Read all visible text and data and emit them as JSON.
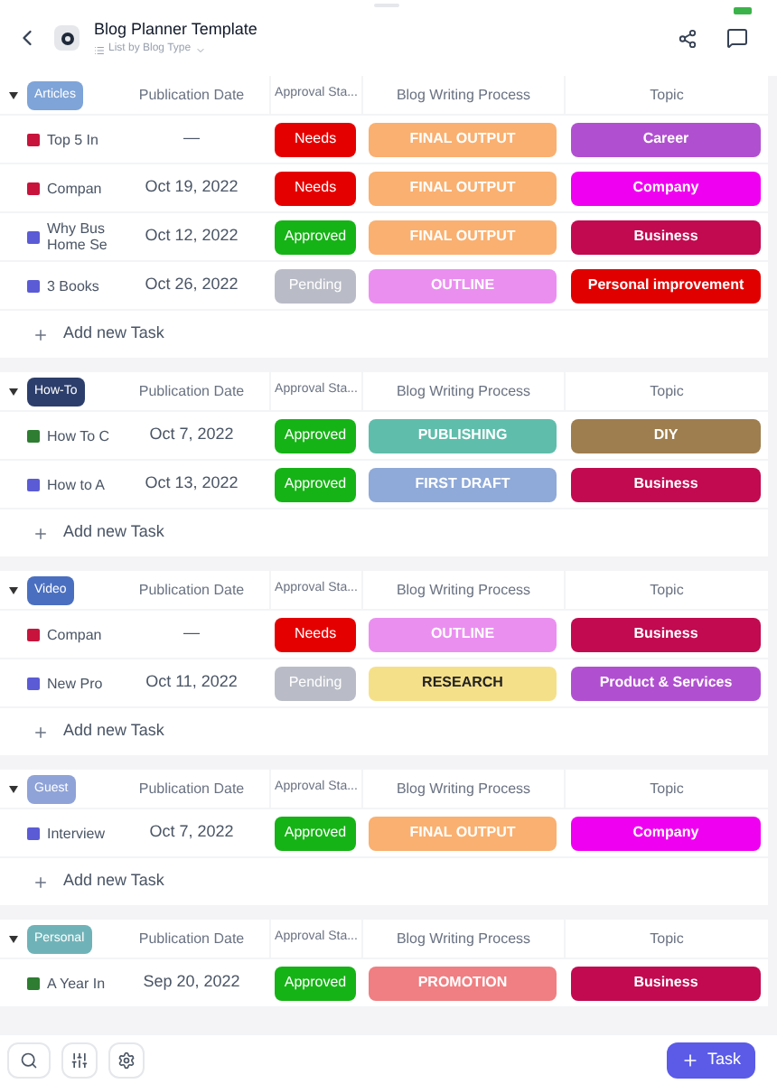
{
  "header": {
    "title": "Blog Planner Template",
    "subtitle": "List by Blog Type"
  },
  "groups": [
    {
      "tag": "Articles",
      "color": "#7ea4d8",
      "expanded": true,
      "columns": [
        "Publication Date",
        "Approval Sta...",
        "Blog Writing Process",
        "Topic"
      ],
      "add_task": "Add new Task",
      "tasks": [
        {
          "name": "Top 5 In",
          "color": "#c8143c",
          "date": "—",
          "approval": {
            "label": "Needs",
            "color": "#e50000"
          },
          "process": {
            "label": "FINAL OUTPUT",
            "color": "#f9b070"
          },
          "topic": {
            "label": "Career",
            "color": "#b050d0"
          }
        },
        {
          "name": "Compan",
          "color": "#c8143c",
          "date": "Oct 19, 2022",
          "approval": {
            "label": "Needs",
            "color": "#e50000"
          },
          "process": {
            "label": "FINAL OUTPUT",
            "color": "#f9b070"
          },
          "topic": {
            "label": "Company",
            "color": "#f000f0"
          }
        },
        {
          "name": "Why Bus Home Se",
          "color": "#5b5bd6",
          "date": "Oct 12, 2022",
          "approval": {
            "label": "Approved",
            "color": "#16b316"
          },
          "process": {
            "label": "FINAL OUTPUT",
            "color": "#f9b070"
          },
          "topic": {
            "label": "Business",
            "color": "#c10a50"
          }
        },
        {
          "name": "3 Books",
          "color": "#5b5bd6",
          "date": "Oct 26, 2022",
          "approval": {
            "label": "Pending",
            "color": "#b9bcc6"
          },
          "process": {
            "label": "OUTLINE",
            "color": "#ea8ff0"
          },
          "topic": {
            "label": "Personal improvement",
            "color": "#e00000"
          }
        }
      ]
    },
    {
      "tag": "How-To",
      "color": "#2c3e6b",
      "expanded": true,
      "columns": [
        "Publication Date",
        "Approval Sta...",
        "Blog Writing Process",
        "Topic"
      ],
      "add_task": "Add new Task",
      "tasks": [
        {
          "name": "How To C",
          "color": "#2e7d32",
          "date": "Oct 7, 2022",
          "approval": {
            "label": "Approved",
            "color": "#16b316"
          },
          "process": {
            "label": "PUBLISHING",
            "color": "#5fbdab"
          },
          "topic": {
            "label": "DIY",
            "color": "#9e7d4e"
          }
        },
        {
          "name": "How to A",
          "color": "#5b5bd6",
          "date": "Oct 13, 2022",
          "approval": {
            "label": "Approved",
            "color": "#16b316"
          },
          "process": {
            "label": "FIRST DRAFT",
            "color": "#8fa9d8"
          },
          "topic": {
            "label": "Business",
            "color": "#c10a50"
          }
        }
      ]
    },
    {
      "tag": "Video",
      "color": "#4a6fc0",
      "expanded": true,
      "columns": [
        "Publication Date",
        "Approval Sta...",
        "Blog Writing Process",
        "Topic"
      ],
      "add_task": "Add new Task",
      "tasks": [
        {
          "name": "Compan",
          "color": "#c8143c",
          "date": "—",
          "approval": {
            "label": "Needs",
            "color": "#e50000"
          },
          "process": {
            "label": "OUTLINE",
            "color": "#ea8ff0"
          },
          "topic": {
            "label": "Business",
            "color": "#c10a50"
          }
        },
        {
          "name": "New Pro",
          "color": "#5b5bd6",
          "date": "Oct 11, 2022",
          "approval": {
            "label": "Pending",
            "color": "#b9bcc6"
          },
          "process": {
            "label": "RESEARCH",
            "color": "#f5e08a"
          },
          "topic": {
            "label": "Product & Services",
            "color": "#b050d0"
          }
        }
      ]
    },
    {
      "tag": "Guest",
      "color": "#8fa3d8",
      "expanded": true,
      "columns": [
        "Publication Date",
        "Approval Sta...",
        "Blog Writing Process",
        "Topic"
      ],
      "add_task": "Add new Task",
      "tasks": [
        {
          "name": "Interview",
          "color": "#5b5bd6",
          "date": "Oct 7, 2022",
          "approval": {
            "label": "Approved",
            "color": "#16b316"
          },
          "process": {
            "label": "FINAL OUTPUT",
            "color": "#f9b070"
          },
          "topic": {
            "label": "Company",
            "color": "#f000f0"
          }
        }
      ]
    },
    {
      "tag": "Personal",
      "color": "#6fb3b8",
      "expanded": true,
      "columns": [
        "Publication Date",
        "Approval Sta...",
        "Blog Writing Process",
        "Topic"
      ],
      "tasks": [
        {
          "name": "A Year In",
          "color": "#2e7d32",
          "date": "Sep 20, 2022",
          "approval": {
            "label": "Approved",
            "color": "#16b316"
          },
          "process": {
            "label": "PROMOTION",
            "color": "#ef7f82"
          },
          "topic": {
            "label": "Business",
            "color": "#c10a50"
          }
        }
      ]
    }
  ],
  "add_button": "Task"
}
